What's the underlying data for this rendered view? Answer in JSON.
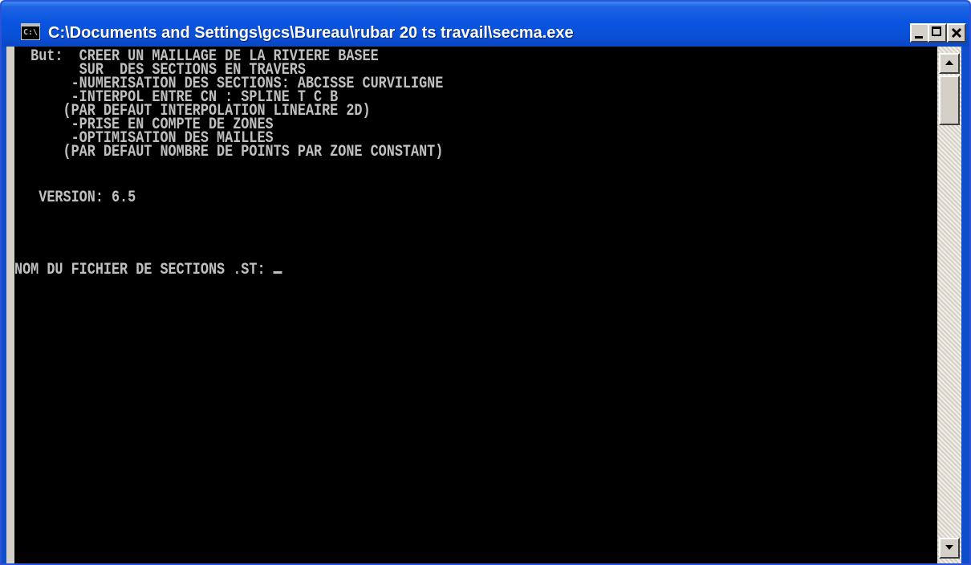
{
  "window": {
    "title": "C:\\Documents and Settings\\gcs\\Bureau\\rubar 20 ts travail\\secma.exe",
    "icon_text": "C:\\"
  },
  "console": {
    "lines": [
      "  But:  CREER UN MAILLAGE DE LA RIVIERE BASEE",
      "        SUR  DES SECTIONS EN TRAVERS",
      "       -NUMERISATION DES SECTIONS: ABCISSE CURVILIGNE",
      "       -INTERPOL ENTRE CN : SPLINE T C B",
      "      (PAR DEFAUT INTERPOLATION LINEAIRE 2D)",
      "       -PRISE EN COMPTE DE ZONES",
      "       -OPTIMISATION DES MAILLES",
      "      (PAR DEFAUT NOMBRE DE POINTS PAR ZONE CONSTANT)",
      "",
      "   VERSION: 6.5"
    ],
    "prompt": "NOM DU FICHIER DE SECTIONS .ST: "
  },
  "icons": {
    "app": "console-icon",
    "minimize": "minimize-icon",
    "maximize": "maximize-icon",
    "close": "close-icon",
    "scroll_up": "arrow-up-icon",
    "scroll_down": "arrow-down-icon"
  },
  "colors": {
    "title_bar": "#0a55e0",
    "console_bg": "#000000",
    "console_text": "#c0c0c0"
  }
}
